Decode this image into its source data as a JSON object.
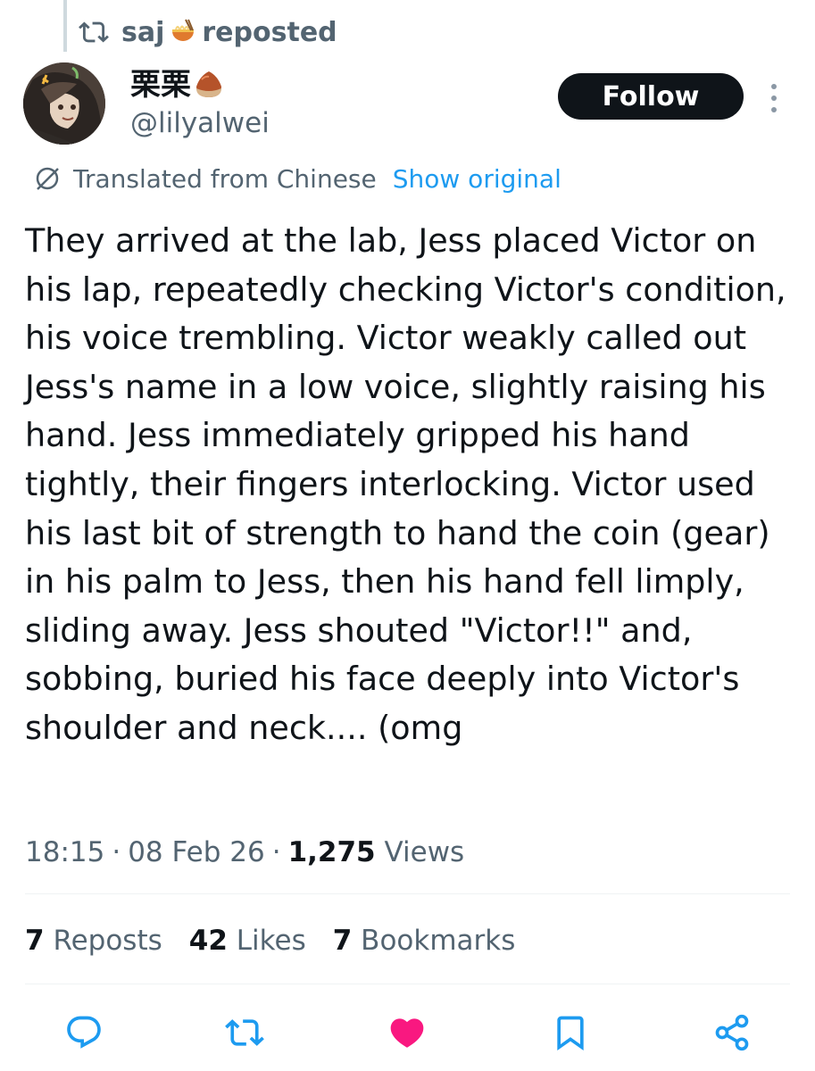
{
  "repost_banner": {
    "user": "saj",
    "emoji": "ramen-bowl",
    "suffix": "reposted"
  },
  "author": {
    "display_name": "栗栗",
    "name_emoji": "chestnut",
    "handle": "@lilyalwei"
  },
  "follow_label": "Follow",
  "translation": {
    "note": "Translated from Chinese",
    "show_original": "Show original"
  },
  "tweet_text": "They arrived at the lab, Jess placed Victor on his lap, repeatedly checking Victor's condition, his voice trembling. Victor weakly called out Jess's name in a low voice, slightly raising his hand. Jess immediately gripped his hand tightly, their fingers interlocking. Victor used his last bit of strength to hand the coin (gear) in his palm to Jess, then his hand fell limply, sliding away. Jess shouted \"Victor!!\" and, sobbing, buried his face deeply into Victor's shoulder and neck.... (omg",
  "meta": {
    "time": "18:15",
    "date": "08 Feb 26",
    "views_count": "1,275",
    "views_label": "Views",
    "separator": "·"
  },
  "stats": {
    "reposts": {
      "count": "7",
      "label": "Reposts"
    },
    "likes": {
      "count": "42",
      "label": "Likes"
    },
    "bookmarks": {
      "count": "7",
      "label": "Bookmarks"
    }
  },
  "actions": [
    "reply-icon",
    "repost-icon",
    "like-icon",
    "bookmark-icon",
    "share-icon"
  ],
  "colors": {
    "accent": "#1d9bf0",
    "like": "#f91880",
    "muted": "#536471",
    "text": "#0f1419"
  }
}
